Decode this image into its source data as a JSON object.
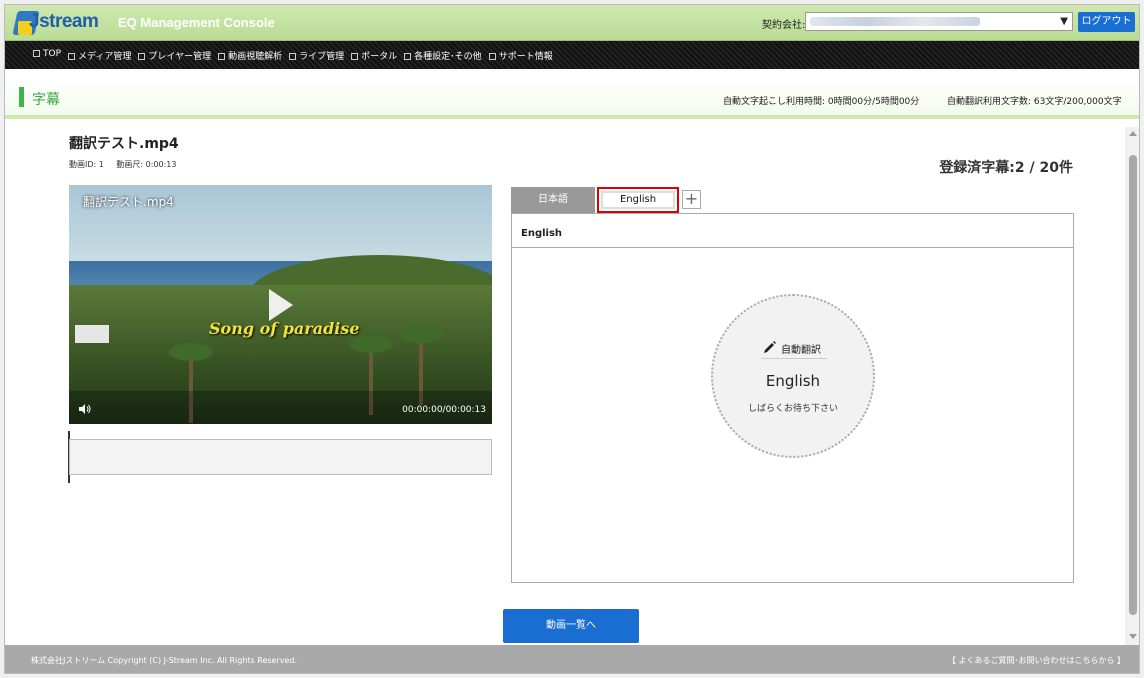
{
  "header": {
    "logo_text": "Jstream",
    "app_title": "EQ Management Console",
    "contract_label": "契約会社:",
    "logout_label": "ログアウト"
  },
  "nav": {
    "items": [
      {
        "label": "TOP"
      },
      {
        "label": "メディア管理"
      },
      {
        "label": "プレイヤー管理"
      },
      {
        "label": "動画視聴解析"
      },
      {
        "label": "ライブ管理"
      },
      {
        "label": "ポータル"
      },
      {
        "label": "各種設定･その他"
      },
      {
        "label": "サポート情報"
      }
    ]
  },
  "page": {
    "title": "字幕",
    "usage_transcription": "自動文字起こし利用時間: 0時間00分/5時間00分",
    "usage_translation": "自動翻訳利用文字数: 63文字/200,000文字"
  },
  "video": {
    "title": "翻訳テスト.mp4",
    "id_label": "動画ID: 1",
    "duration_label": "動画尺: 0:00:13",
    "player_title": "翻訳テスト.mp4",
    "caption_overlay": "Song of paradise",
    "time_readout": "00:00:00/00:00:13"
  },
  "subtitles": {
    "count_label": "登録済字幕:2 / 20件",
    "tabs": [
      {
        "label": "日本語",
        "active": false
      },
      {
        "label": "English",
        "active": true
      }
    ],
    "add_tab_label": "+",
    "panel_header": "English",
    "status": {
      "action_label": "自動翻訳",
      "language": "English",
      "message": "しばらくお待ち下さい"
    }
  },
  "actions": {
    "back_to_list": "動画一覧へ"
  },
  "footer": {
    "copyright": "株式会社Jストリーム  Copyright (C) J-Stream Inc. All Rights Reserved.",
    "contact": "【 よくあるご質問･お問い合わせはこちらから 】"
  },
  "colors": {
    "header_green": "#b9dc94",
    "accent_green": "#3cb54a",
    "primary_blue": "#1a6ed1",
    "highlight_red": "#e00000"
  },
  "icons": {
    "pencil": "pencil-icon",
    "volume": "volume-icon",
    "play": "play-icon"
  }
}
